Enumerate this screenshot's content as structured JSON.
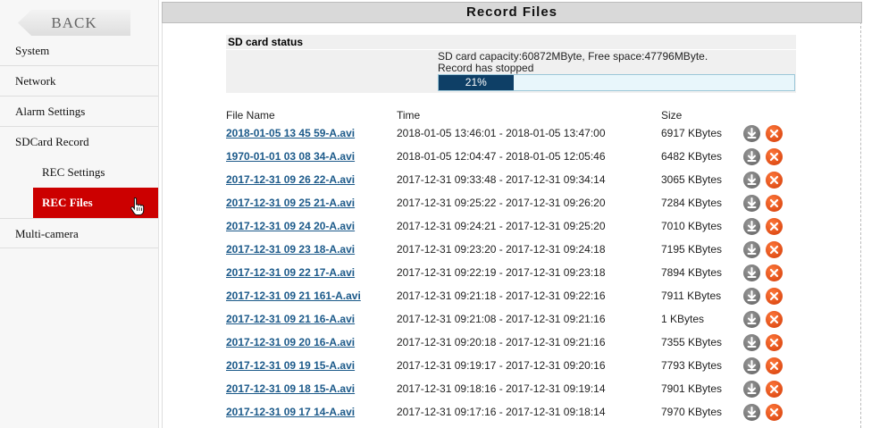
{
  "sidebar": {
    "back_label": "BACK",
    "items": [
      {
        "label": "System"
      },
      {
        "label": "Network"
      },
      {
        "label": "Alarm Settings"
      },
      {
        "label": "SDCard Record"
      },
      {
        "label": "REC Settings"
      },
      {
        "label": "REC Files"
      },
      {
        "label": "Multi-camera"
      }
    ]
  },
  "page": {
    "title": "Record Files"
  },
  "sd_status": {
    "header": "SD card status",
    "capacity_line": "SD card capacity:60872MByte,  Free space:47796MByte.",
    "status_line": "Record has stopped",
    "usage_percent": 21,
    "usage_label": "21%"
  },
  "table": {
    "columns": {
      "name": "File Name",
      "time": "Time",
      "size": "Size"
    },
    "rows": [
      {
        "name": "2018-01-05 13 45 59-A.avi",
        "time": "2018-01-05 13:46:01 - 2018-01-05 13:47:00",
        "size": "6917 KBytes"
      },
      {
        "name": "1970-01-01 03 08 34-A.avi",
        "time": "2018-01-05 12:04:47 - 2018-01-05 12:05:46",
        "size": "6482 KBytes"
      },
      {
        "name": "2017-12-31 09 26 22-A.avi",
        "time": "2017-12-31 09:33:48 - 2017-12-31 09:34:14",
        "size": "3065 KBytes"
      },
      {
        "name": "2017-12-31 09 25 21-A.avi",
        "time": "2017-12-31 09:25:22 - 2017-12-31 09:26:20",
        "size": "7284 KBytes"
      },
      {
        "name": "2017-12-31 09 24 20-A.avi",
        "time": "2017-12-31 09:24:21 - 2017-12-31 09:25:20",
        "size": "7010 KBytes"
      },
      {
        "name": "2017-12-31 09 23 18-A.avi",
        "time": "2017-12-31 09:23:20 - 2017-12-31 09:24:18",
        "size": "7195 KBytes"
      },
      {
        "name": "2017-12-31 09 22 17-A.avi",
        "time": "2017-12-31 09:22:19 - 2017-12-31 09:23:18",
        "size": "7894 KBytes"
      },
      {
        "name": "2017-12-31 09 21 161-A.avi",
        "time": "2017-12-31 09:21:18 - 2017-12-31 09:22:16",
        "size": "7911 KBytes"
      },
      {
        "name": "2017-12-31 09 21 16-A.avi",
        "time": "2017-12-31 09:21:08 - 2017-12-31 09:21:16",
        "size": "1 KBytes"
      },
      {
        "name": "2017-12-31 09 20 16-A.avi",
        "time": "2017-12-31 09:20:18 - 2017-12-31 09:21:16",
        "size": "7355 KBytes"
      },
      {
        "name": "2017-12-31 09 19 15-A.avi",
        "time": "2017-12-31 09:19:17 - 2017-12-31 09:20:16",
        "size": "7793 KBytes"
      },
      {
        "name": "2017-12-31 09 18 15-A.avi",
        "time": "2017-12-31 09:18:16 - 2017-12-31 09:19:14",
        "size": "7901 KBytes"
      },
      {
        "name": "2017-12-31 09 17 14-A.avi",
        "time": "2017-12-31 09:17:16 - 2017-12-31 09:18:14",
        "size": "7970 KBytes"
      }
    ]
  },
  "icons": {
    "download": "download-icon",
    "delete": "delete-icon",
    "cursor": "hand-pointer-icon"
  },
  "colors": {
    "active_nav": "#cc0000",
    "link": "#1c5a8a",
    "progress_fill": "#0e3f66",
    "delete_icon": "#e0450c",
    "download_icon": "#707070"
  }
}
